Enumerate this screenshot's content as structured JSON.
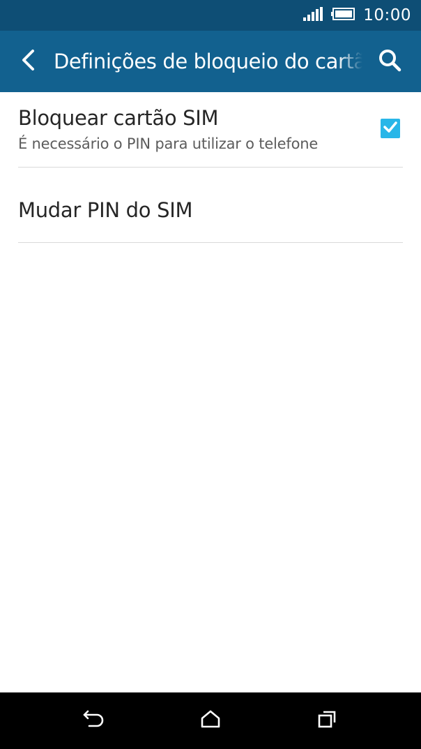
{
  "status_bar": {
    "time": "10:00",
    "icons": [
      "signal-icon",
      "battery-icon"
    ]
  },
  "app_bar": {
    "title": "Definições de bloqueio do cartão SIM",
    "icons": [
      "back-arrow-icon",
      "search-icon"
    ]
  },
  "settings": {
    "items": [
      {
        "title": "Bloquear cartão SIM",
        "subtitle": "É necessário o PIN para utilizar o telefone",
        "checked": true
      },
      {
        "title": "Mudar PIN do SIM"
      }
    ]
  },
  "nav_bar": {
    "icons": [
      "back-icon",
      "home-icon",
      "recents-icon"
    ]
  },
  "colors": {
    "status_bar": "#0e4e75",
    "app_bar": "#12618f",
    "checkbox": "#29b6e8",
    "nav_bar": "#000000"
  }
}
